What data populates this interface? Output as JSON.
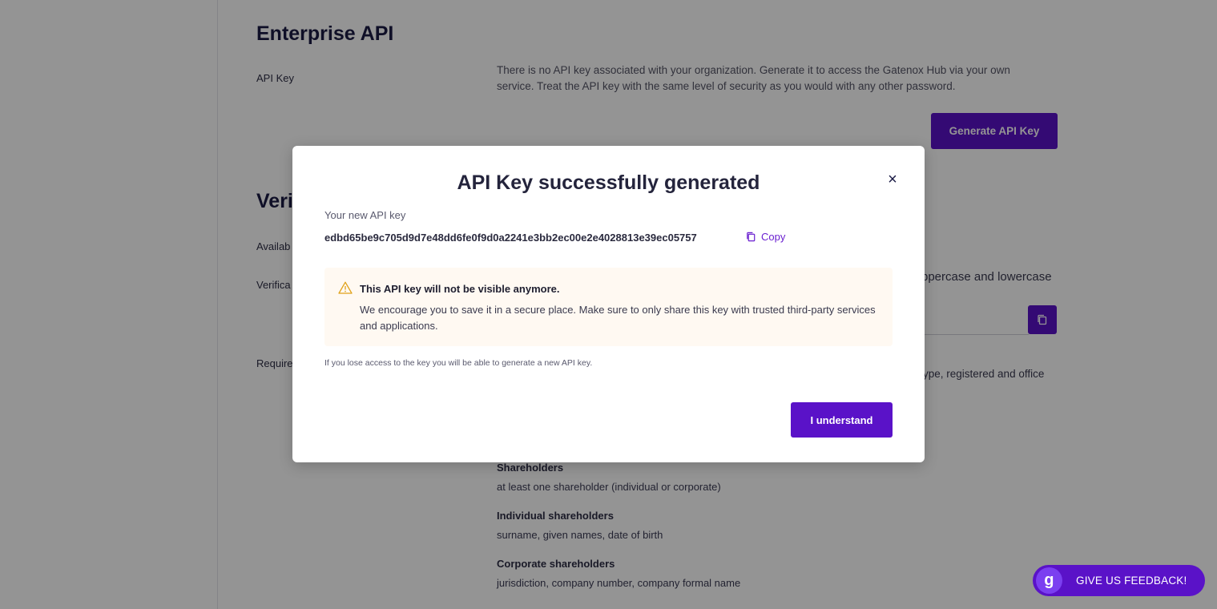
{
  "background": {
    "section1_title": "Enterprise API",
    "api_key_label": "API Key",
    "api_key_description": "There is no API key associated with your organization. Generate it to access the Gatenox Hub via your own service. Treat the API key with the same level of security as you would with any other password.",
    "generate_button": "Generate API Key",
    "section2_title_partial": "Veri",
    "available_label_partial": "Availab",
    "verification_label_partial": "Verifica",
    "required_label_partial": "Require",
    "right_text_1": "ppercase and lowercase",
    "right_text_2": "ype, registered and office",
    "shareholders_title": "Shareholders",
    "shareholders_sub": "at least one shareholder (individual or corporate)",
    "individual_title": "Individual shareholders",
    "individual_sub": "surname, given names, date of birth",
    "corporate_title": "Corporate shareholders",
    "corporate_sub": "jurisdiction, company number, company formal name"
  },
  "modal": {
    "title": "API Key successfully generated",
    "close_label": "×",
    "key_label": "Your new API key",
    "key_value": "edbd65be9c705d9d7e48dd6fe0f9d0a2241e3bb2ec00e2e4028813e39ec05757",
    "copy_label": "Copy",
    "warning_title": "This API key will not be visible anymore.",
    "warning_body": "We encourage you to save it in a secure place. Make sure to only share this key with trusted third-party services and applications.",
    "lose_note": "If you lose access to the key you will be able to generate a new API key.",
    "confirm_button": "I understand"
  },
  "feedback": {
    "label": "GIVE US FEEDBACK!",
    "logo_letter": "g"
  },
  "colors": {
    "primary": "#5a12c8",
    "warning_bg": "#fff9f2",
    "warning_icon": "#e0a21a"
  },
  "icons": [
    "close-icon",
    "copy-icon",
    "warning-icon",
    "gatenox-logo-icon"
  ]
}
